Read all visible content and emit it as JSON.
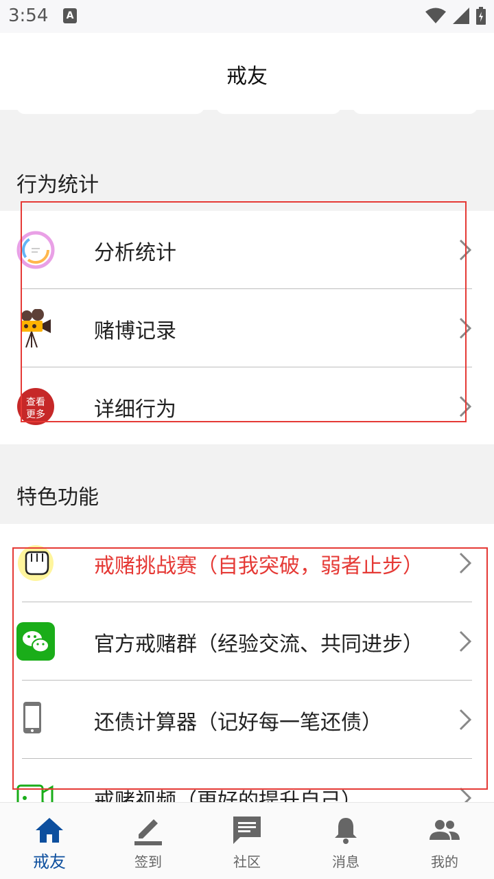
{
  "status_bar": {
    "time": "3:54",
    "notif_glyph": "A"
  },
  "header": {
    "title": "戒友"
  },
  "sections": [
    {
      "title": "行为统计",
      "items": [
        {
          "label": "分析统计",
          "icon": "pie-chart-icon"
        },
        {
          "label": "赌博记录",
          "icon": "film-camera-icon"
        },
        {
          "label": "详细行为",
          "icon": "view-more-stamp-icon",
          "stamp_text": "查看更多"
        }
      ]
    },
    {
      "title": "特色功能",
      "items": [
        {
          "label": "戒赌挑战赛（自我突破，弱者止步）",
          "icon": "fist-icon",
          "color": "#e53935"
        },
        {
          "label": "官方戒赌群（经验交流、共同进步）",
          "icon": "wechat-icon",
          "color": "#1aad19"
        },
        {
          "label": "还债计算器（记好每一笔还债）",
          "icon": "phone-icon"
        },
        {
          "label": "戒赌视频（更好的提升自己）",
          "icon": "video-icon"
        }
      ]
    }
  ],
  "bottom_nav": [
    {
      "label": "戒友",
      "icon": "home-icon",
      "active": true
    },
    {
      "label": "签到",
      "icon": "pen-icon",
      "active": false
    },
    {
      "label": "社区",
      "icon": "chat-icon",
      "active": false
    },
    {
      "label": "消息",
      "icon": "bell-icon",
      "active": false
    },
    {
      "label": "我的",
      "icon": "people-icon",
      "active": false
    }
  ],
  "colors": {
    "accent": "#0d4f9e",
    "highlight": "#e53935"
  }
}
